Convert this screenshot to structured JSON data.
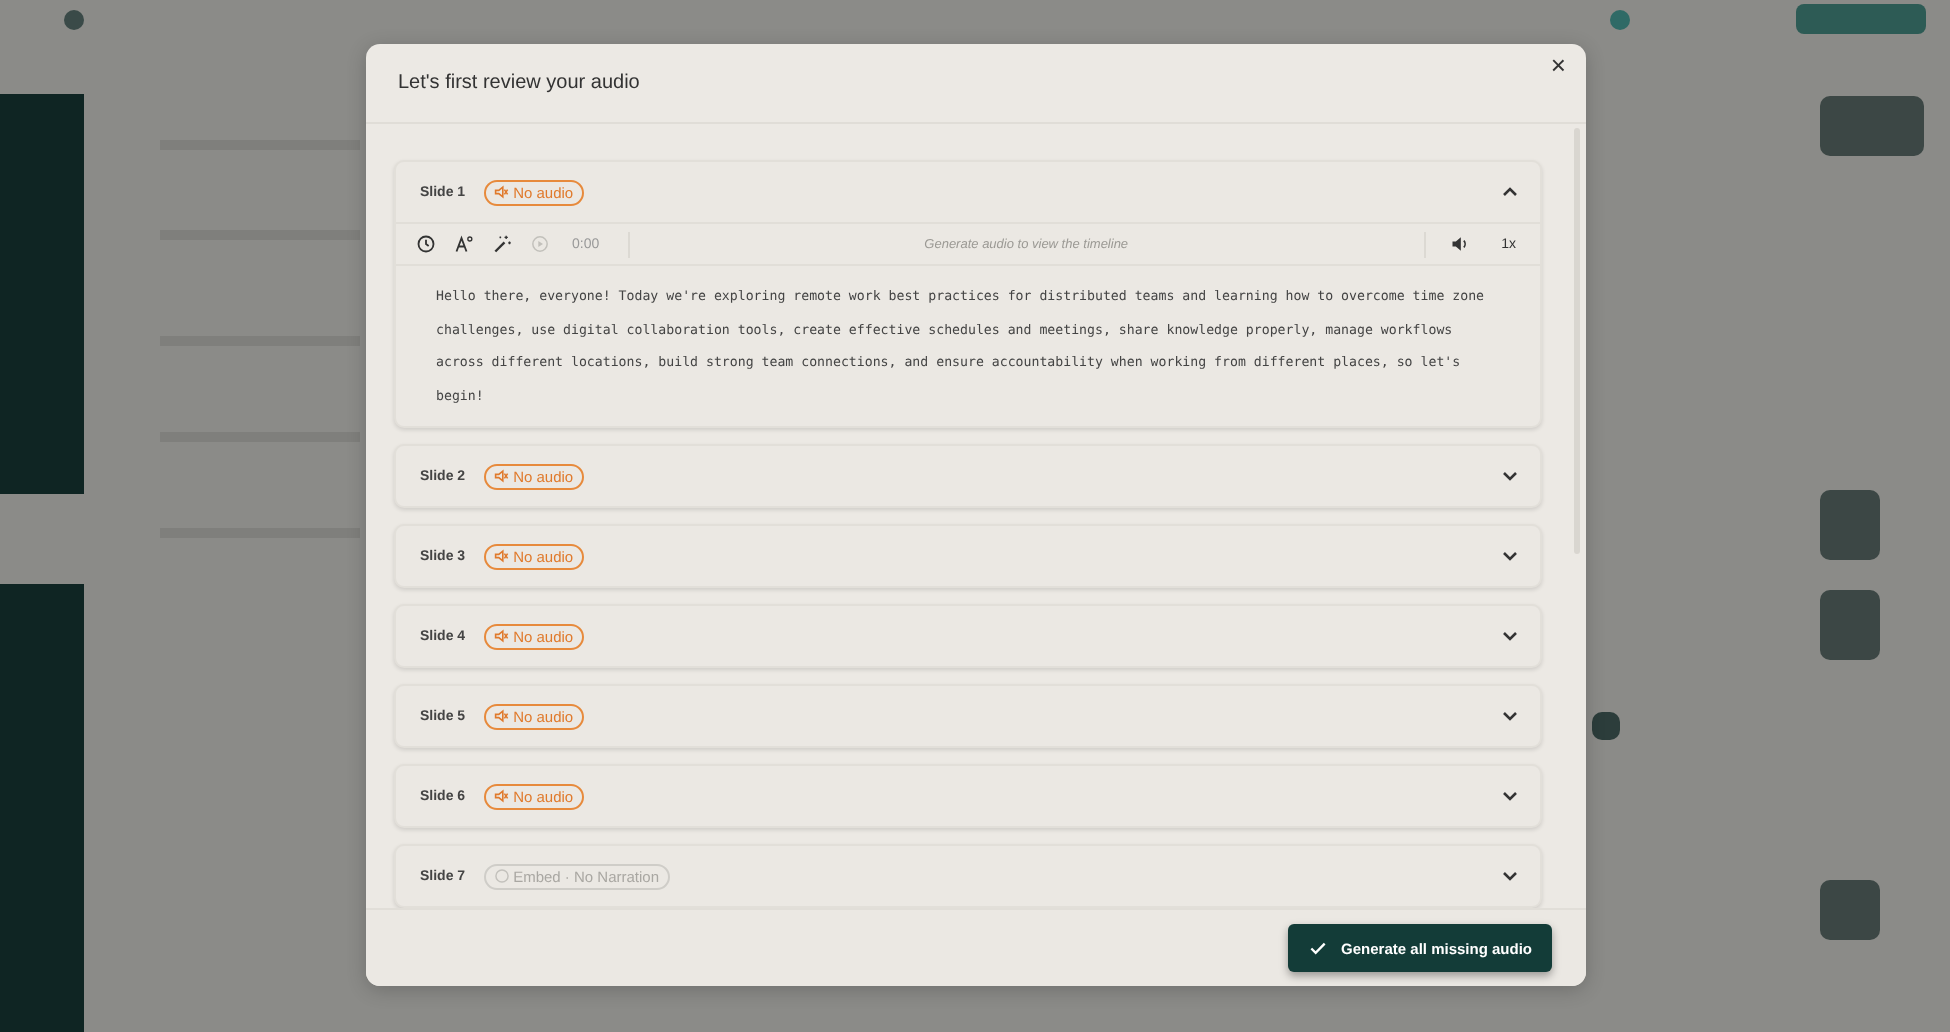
{
  "modal": {
    "title": "Let's first review your audio",
    "close": "×"
  },
  "slides": [
    {
      "label": "Slide 1",
      "expanded": true,
      "badge": {
        "kind": "no_audio",
        "text": "No audio"
      },
      "player": {
        "time": "0:00",
        "timeline": "Generate audio to view the timeline",
        "speed": "1x"
      },
      "script": "Hello there, everyone! Today we're exploring remote work best practices for distributed teams and learning how to overcome time zone challenges, use digital collaboration tools, create effective schedules and meetings, share knowledge properly, manage workflows across different locations, build strong team connections, and ensure accountability when working from different places, so let's begin!"
    },
    {
      "label": "Slide 2",
      "expanded": false,
      "badge": {
        "kind": "no_audio",
        "text": "No audio"
      }
    },
    {
      "label": "Slide 3",
      "expanded": false,
      "badge": {
        "kind": "no_audio",
        "text": "No audio"
      }
    },
    {
      "label": "Slide 4",
      "expanded": false,
      "badge": {
        "kind": "no_audio",
        "text": "No audio"
      }
    },
    {
      "label": "Slide 5",
      "expanded": false,
      "badge": {
        "kind": "no_audio",
        "text": "No audio"
      }
    },
    {
      "label": "Slide 6",
      "expanded": false,
      "badge": {
        "kind": "no_audio",
        "text": "No audio"
      }
    },
    {
      "label": "Slide 7",
      "expanded": false,
      "badge": {
        "kind": "embed",
        "text": "Embed · No Narration"
      }
    }
  ],
  "footer": {
    "primary_button": "Generate all missing audio"
  }
}
